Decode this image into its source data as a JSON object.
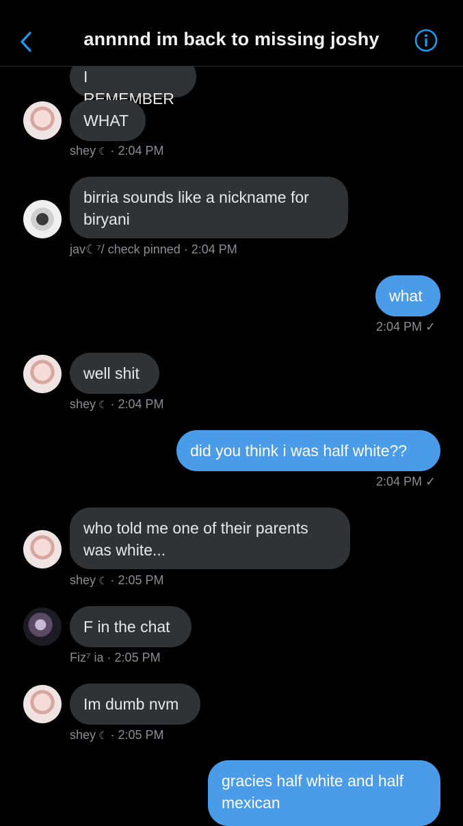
{
  "header": {
    "title": "annnnd im back to missing joshy",
    "back_icon": "chevron-left-icon",
    "info_icon": "info-icon"
  },
  "colors": {
    "background": "#000000",
    "incoming_bubble": "#2f3336",
    "outgoing_bubble": "#4a9be8",
    "accent": "#1d9bf0",
    "meta_text": "#8b8e92"
  },
  "messages": [
    {
      "dir": "in",
      "text": "I REMEMBER"
    },
    {
      "dir": "in",
      "text": "WHAT",
      "sender": "shey",
      "moon": "☾",
      "time": "· 2:04 PM"
    },
    {
      "dir": "in",
      "text": "birria sounds like a nickname for biryani",
      "sender": "jav☾⁷/ check pinned",
      "time": "· 2:04 PM"
    },
    {
      "dir": "out",
      "text": "what",
      "time": "2:04 PM ✓"
    },
    {
      "dir": "in",
      "text": "well shit",
      "sender": "shey",
      "moon": "☾",
      "time": "· 2:04 PM"
    },
    {
      "dir": "out",
      "text": "did you think i was half white??",
      "time": "2:04 PM ✓"
    },
    {
      "dir": "in",
      "text": "who told me one of their parents was white...",
      "sender": "shey",
      "moon": "☾",
      "time": "· 2:05 PM"
    },
    {
      "dir": "in",
      "text": "F in the chat",
      "sender": "Fiz⁷ ia",
      "time": "· 2:05 PM"
    },
    {
      "dir": "in",
      "text": "Im dumb nvm",
      "sender": "shey",
      "moon": "☾",
      "time": "· 2:05 PM"
    },
    {
      "dir": "out",
      "text": "gracies half white and half mexican"
    }
  ]
}
